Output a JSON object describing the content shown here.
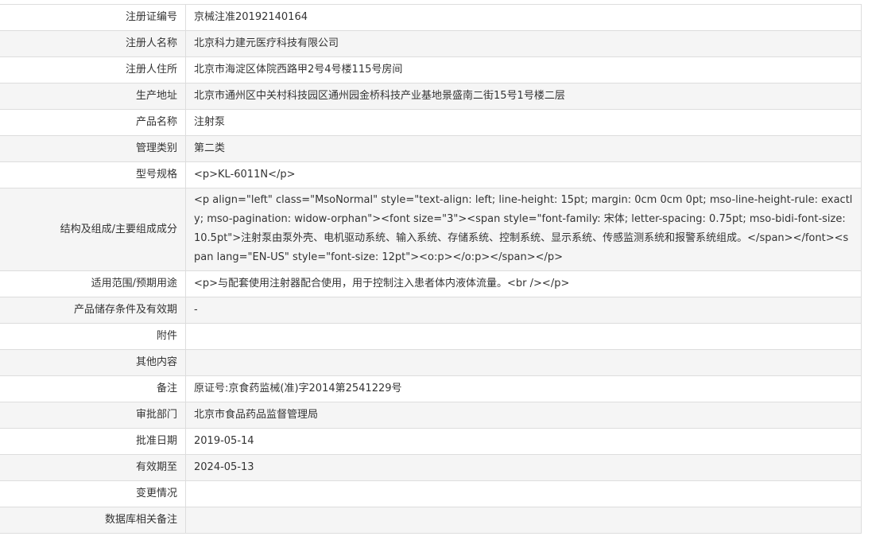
{
  "rows": [
    {
      "label": "注册证编号",
      "value": "京械注准20192140164"
    },
    {
      "label": "注册人名称",
      "value": "北京科力建元医疗科技有限公司"
    },
    {
      "label": "注册人住所",
      "value": "北京市海淀区体院西路甲2号4号楼115号房间"
    },
    {
      "label": "生产地址",
      "value": "北京市通州区中关村科技园区通州园金桥科技产业基地景盛南二街15号1号楼二层"
    },
    {
      "label": "产品名称",
      "value": "注射泵"
    },
    {
      "label": "管理类别",
      "value": "第二类"
    },
    {
      "label": "型号规格",
      "value": "<p>KL-6011N</p>"
    },
    {
      "label": "结构及组成/主要组成成分",
      "value": "<p align=\"left\" class=\"MsoNormal\" style=\"text-align: left; line-height: 15pt; margin: 0cm 0cm 0pt; mso-line-height-rule: exactly; mso-pagination: widow-orphan\"><font size=\"3\"><span style=\"font-family: 宋体; letter-spacing: 0.75pt; mso-bidi-font-size: 10.5pt\">注射泵由泵外壳、电机驱动系统、输入系统、存储系统、控制系统、显示系统、传感监测系统和报警系统组成。</span></font><span lang=\"EN-US\" style=\"font-size: 12pt\"><o:p></o:p></span></p>"
    },
    {
      "label": "适用范围/预期用途",
      "value": "<p>与配套使用注射器配合使用，用于控制注入患者体内液体流量。<br /></p>"
    },
    {
      "label": "产品储存条件及有效期",
      "value": "-"
    },
    {
      "label": "附件",
      "value": ""
    },
    {
      "label": "其他内容",
      "value": ""
    },
    {
      "label": "备注",
      "value": "原证号:京食药监械(准)字2014第2541229号"
    },
    {
      "label": "审批部门",
      "value": "北京市食品药品监督管理局"
    },
    {
      "label": "批准日期",
      "value": "2019-05-14"
    },
    {
      "label": "有效期至",
      "value": "2024-05-13"
    },
    {
      "label": "变更情况",
      "value": ""
    },
    {
      "label": "数据库相关备注",
      "value": ""
    }
  ]
}
